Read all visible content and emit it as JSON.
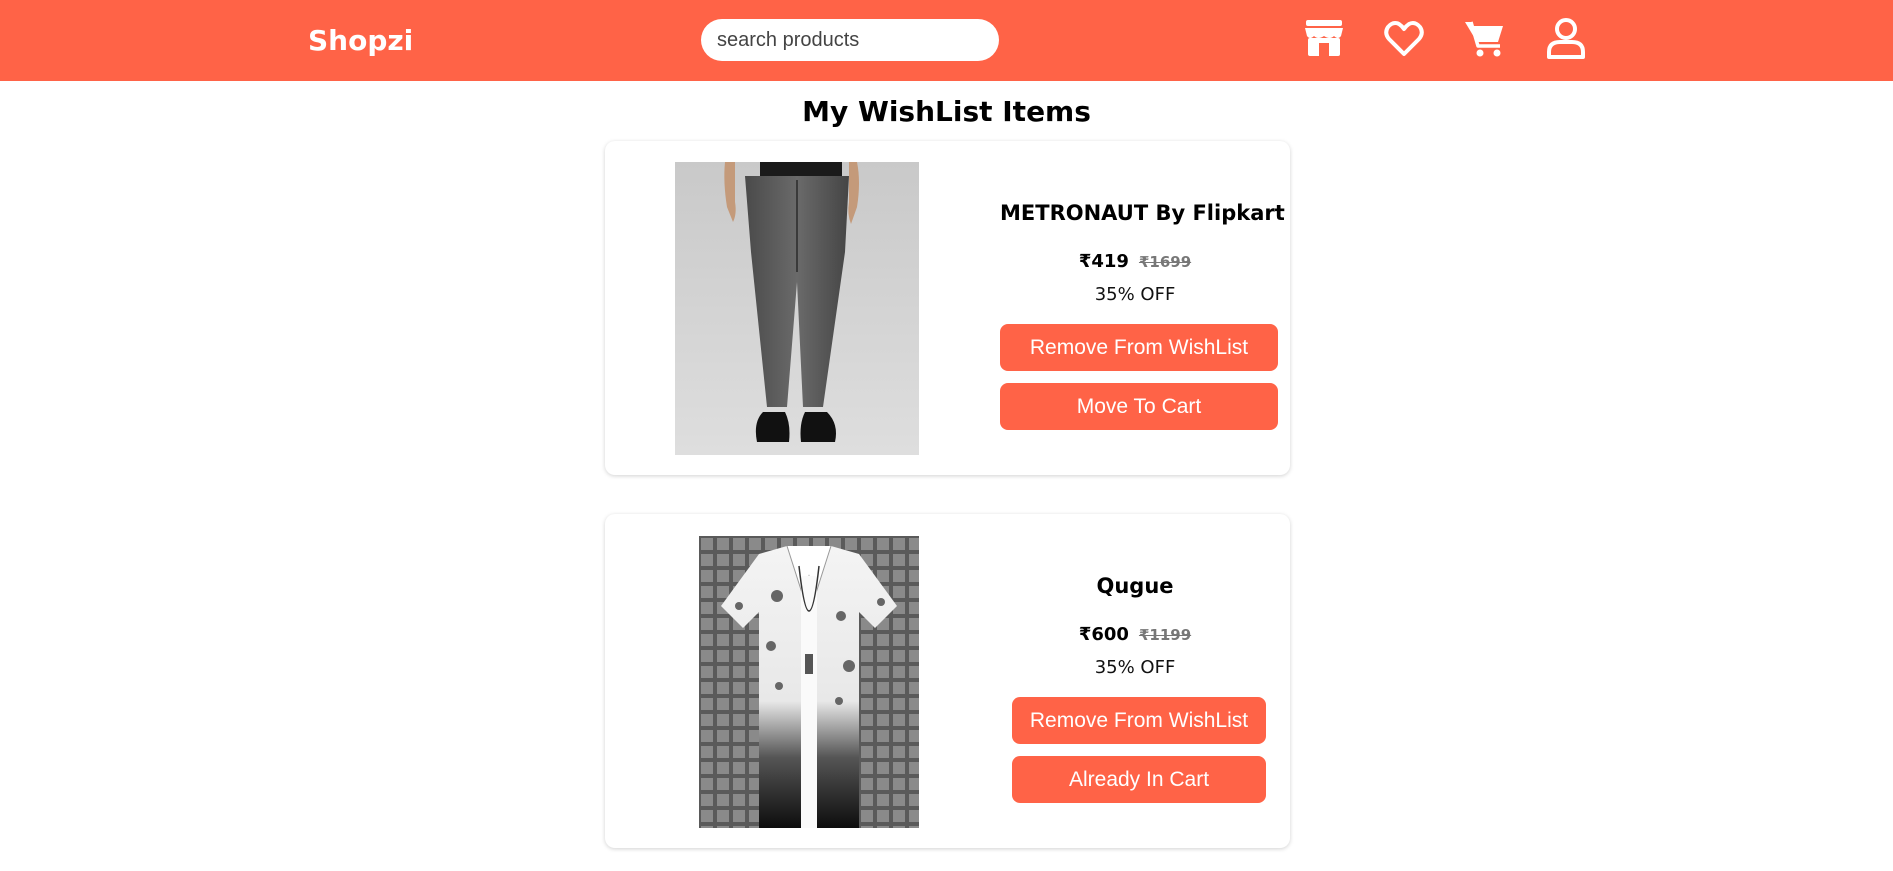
{
  "header": {
    "brand": "Shopzi",
    "search_placeholder": "search products",
    "icons": [
      "store-icon",
      "heart-icon",
      "cart-icon",
      "user-icon"
    ]
  },
  "title": "My WishList Items",
  "currency_symbol": "₹",
  "items": [
    {
      "name": "METRONAUT By Flipkart",
      "price": "₹419",
      "mrp": "₹1699",
      "discount": "35% OFF",
      "remove_label": "Remove From WishList",
      "action_label": "Move To Cart",
      "image": "jeans-photo"
    },
    {
      "name": "Qugue",
      "price": "₹600",
      "mrp": "₹1199",
      "discount": "35% OFF",
      "remove_label": "Remove From WishList",
      "action_label": "Already In Cart",
      "image": "shirt-photo"
    }
  ],
  "colors": {
    "accent": "#ff6347",
    "white": "#ffffff",
    "strike": "#777777"
  }
}
